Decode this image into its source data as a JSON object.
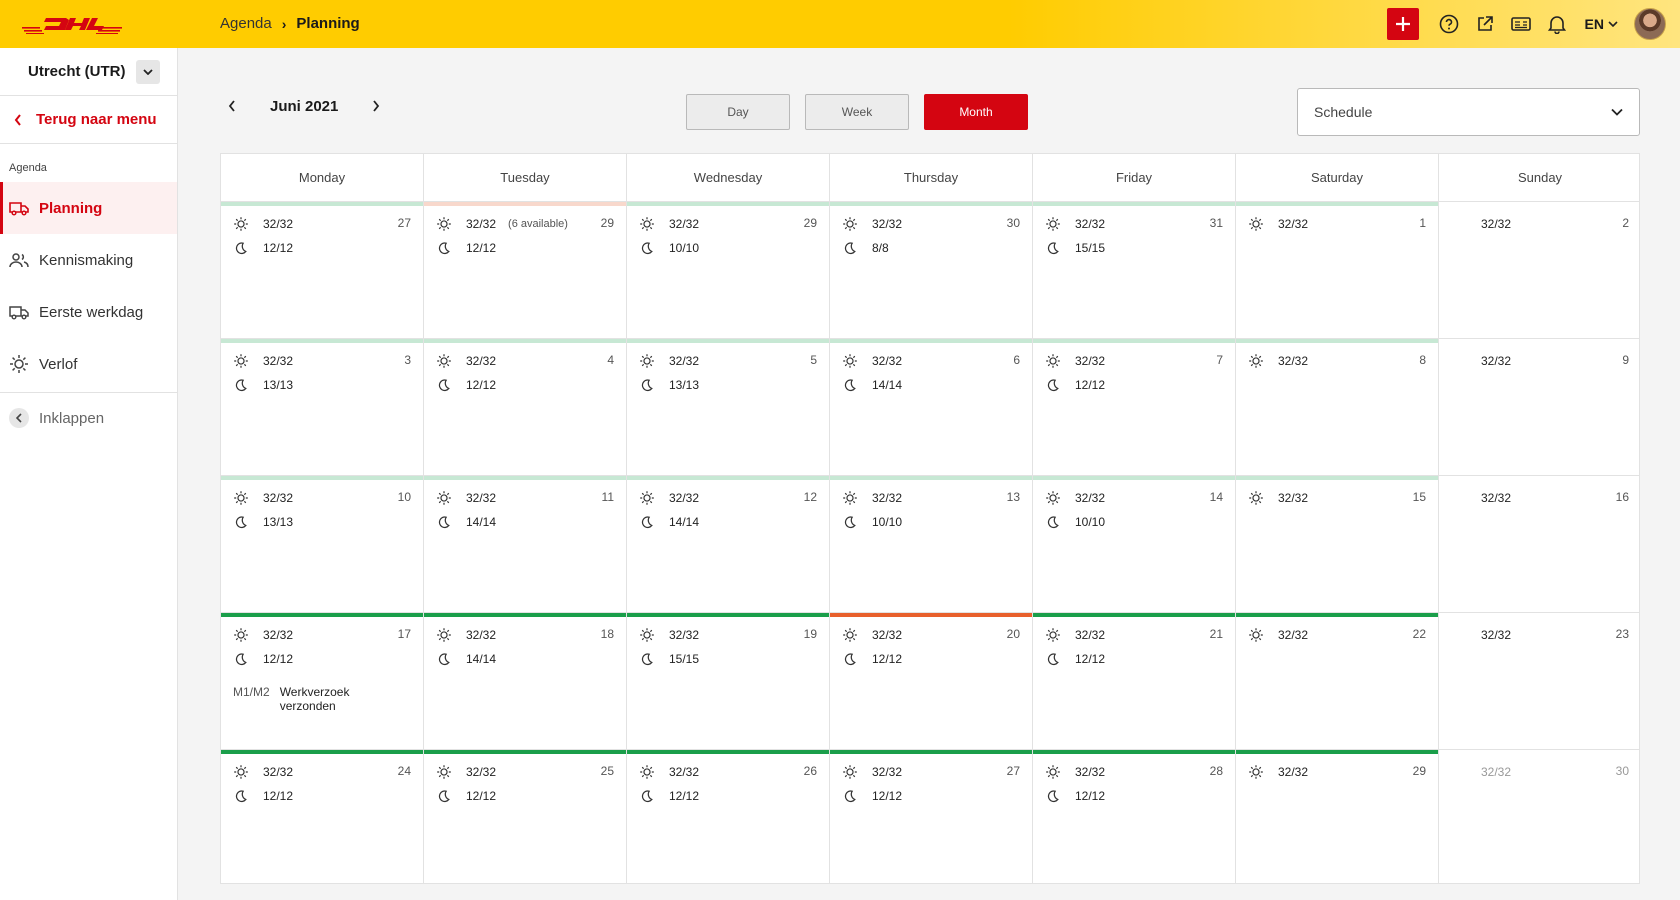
{
  "colors": {
    "brand_red": "#d40511",
    "brand_yellow": "#ffcc00",
    "status_green_light": "#c7e8d4",
    "status_orange_light": "#f8d8cc",
    "status_green": "#1a9e4a",
    "status_orange": "#e8602c"
  },
  "header": {
    "logo_text": "DHL",
    "breadcrumb": [
      "Agenda",
      "Planning"
    ],
    "lang": "EN",
    "icons": [
      "plus-icon",
      "help-icon",
      "external-link-icon",
      "id-card-icon",
      "bell-icon"
    ]
  },
  "sidebar": {
    "location": "Utrecht (UTR)",
    "back_label": "Terug naar menu",
    "section": "Agenda",
    "items": [
      {
        "label": "Planning",
        "icon": "truck-icon",
        "active": true
      },
      {
        "label": "Kennismaking",
        "icon": "users-icon",
        "active": false
      },
      {
        "label": "Eerste werkdag",
        "icon": "truck-icon",
        "active": false
      },
      {
        "label": "Verlof",
        "icon": "sun-icon",
        "active": false
      }
    ],
    "collapse_label": "Inklappen"
  },
  "toolbar": {
    "month_label": "Juni 2021",
    "views": [
      "Day",
      "Week",
      "Month"
    ],
    "active_view": "Month",
    "schedule_label": "Schedule"
  },
  "calendar": {
    "weekdays": [
      "Monday",
      "Tuesday",
      "Wednesday",
      "Thursday",
      "Friday",
      "Saturday",
      "Sunday"
    ],
    "weeks": [
      [
        {
          "num": "27",
          "day": "32/32",
          "night": "12/12",
          "bar": "light-green"
        },
        {
          "num": "29",
          "day": "32/32",
          "note": "(6 available)",
          "night": "12/12",
          "bar": "light-orange"
        },
        {
          "num": "29",
          "day": "32/32",
          "night": "10/10",
          "bar": "light-green"
        },
        {
          "num": "30",
          "day": "32/32",
          "night": "8/8",
          "bar": "light-green"
        },
        {
          "num": "31",
          "day": "32/32",
          "night": "15/15",
          "bar": "light-green"
        },
        {
          "num": "1",
          "day": "32/32",
          "bar": "light-green"
        },
        {
          "num": "2",
          "day": "32/32",
          "sunday": true
        }
      ],
      [
        {
          "num": "3",
          "day": "32/32",
          "night": "13/13",
          "bar": "light-green"
        },
        {
          "num": "4",
          "day": "32/32",
          "night": "12/12",
          "bar": "light-green"
        },
        {
          "num": "5",
          "day": "32/32",
          "night": "13/13",
          "bar": "light-green"
        },
        {
          "num": "6",
          "day": "32/32",
          "night": "14/14",
          "bar": "light-green"
        },
        {
          "num": "7",
          "day": "32/32",
          "night": "12/12",
          "bar": "light-green"
        },
        {
          "num": "8",
          "day": "32/32",
          "bar": "light-green"
        },
        {
          "num": "9",
          "day": "32/32",
          "sunday": true
        }
      ],
      [
        {
          "num": "10",
          "day": "32/32",
          "night": "13/13",
          "bar": "light-green"
        },
        {
          "num": "11",
          "day": "32/32",
          "night": "14/14",
          "bar": "light-green"
        },
        {
          "num": "12",
          "day": "32/32",
          "night": "14/14",
          "bar": "light-green"
        },
        {
          "num": "13",
          "day": "32/32",
          "night": "10/10",
          "bar": "light-green"
        },
        {
          "num": "14",
          "day": "32/32",
          "night": "10/10",
          "bar": "light-green"
        },
        {
          "num": "15",
          "day": "32/32",
          "bar": "light-green"
        },
        {
          "num": "16",
          "day": "32/32",
          "sunday": true
        }
      ],
      [
        {
          "num": "17",
          "day": "32/32",
          "night": "12/12",
          "bar": "green",
          "event_code": "M1/M2",
          "event_text": "Werkverzoek verzonden"
        },
        {
          "num": "18",
          "day": "32/32",
          "night": "14/14",
          "bar": "green"
        },
        {
          "num": "19",
          "day": "32/32",
          "night": "15/15",
          "bar": "green"
        },
        {
          "num": "20",
          "day": "32/32",
          "night": "12/12",
          "bar": "orange"
        },
        {
          "num": "21",
          "day": "32/32",
          "night": "12/12",
          "bar": "green"
        },
        {
          "num": "22",
          "day": "32/32",
          "bar": "green"
        },
        {
          "num": "23",
          "day": "32/32",
          "sunday": true
        }
      ],
      [
        {
          "num": "24",
          "day": "32/32",
          "night": "12/12",
          "bar": "green"
        },
        {
          "num": "25",
          "day": "32/32",
          "night": "12/12",
          "bar": "green"
        },
        {
          "num": "26",
          "day": "32/32",
          "night": "12/12",
          "bar": "green"
        },
        {
          "num": "27",
          "day": "32/32",
          "night": "12/12",
          "bar": "green"
        },
        {
          "num": "28",
          "day": "32/32",
          "night": "12/12",
          "bar": "green"
        },
        {
          "num": "29",
          "day": "32/32",
          "bar": "green"
        },
        {
          "num": "30",
          "day": "32/32",
          "sunday": true,
          "muted": true
        }
      ]
    ]
  }
}
